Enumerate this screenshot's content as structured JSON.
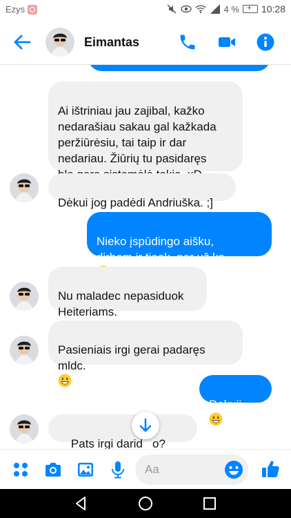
{
  "status_bar": {
    "app_name": "Ezys",
    "battery": "4 %",
    "time": "10:28"
  },
  "header": {
    "contact_name": "Eimantas"
  },
  "messages": [
    {
      "id": "m1",
      "direction": "in",
      "text": "Ai ištriniau jau zajibal, kažko\nnedarašiau sakau gal kažkada\nperžiūrėsiu, tai taip ir dar\nnedariau. Žiūrių tu pasidaręs\nble gera sistemėlė tokia. xD"
    },
    {
      "id": "m2",
      "direction": "in",
      "text": "Dėkui jog padėdi Andriuška. ;]"
    },
    {
      "id": "m3",
      "direction": "out",
      "text": "Nieko įspūdingo aišku,\ndirbam ir tieek, ner už ką",
      "emoji": "grinning-face"
    },
    {
      "id": "m4",
      "direction": "in",
      "text": "Nu maladec nepasiduok\nHeiteriams."
    },
    {
      "id": "m5",
      "direction": "in",
      "text": "Pasieniais irgi gerai padaręs\nmldc.",
      "emoji": "smiling-face"
    },
    {
      "id": "m6",
      "direction": "out",
      "text": "Dekuii",
      "emoji": "smiling-face"
    },
    {
      "id": "m7",
      "direction": "in",
      "text": "Pats irgi darid   o?",
      "emoji": "smiling-face"
    }
  ],
  "composer": {
    "placeholder": "Aa"
  },
  "colors": {
    "accent": "#0084ff",
    "incoming_bubble": "#f1f0f0",
    "emoji": "#ffcc33"
  }
}
